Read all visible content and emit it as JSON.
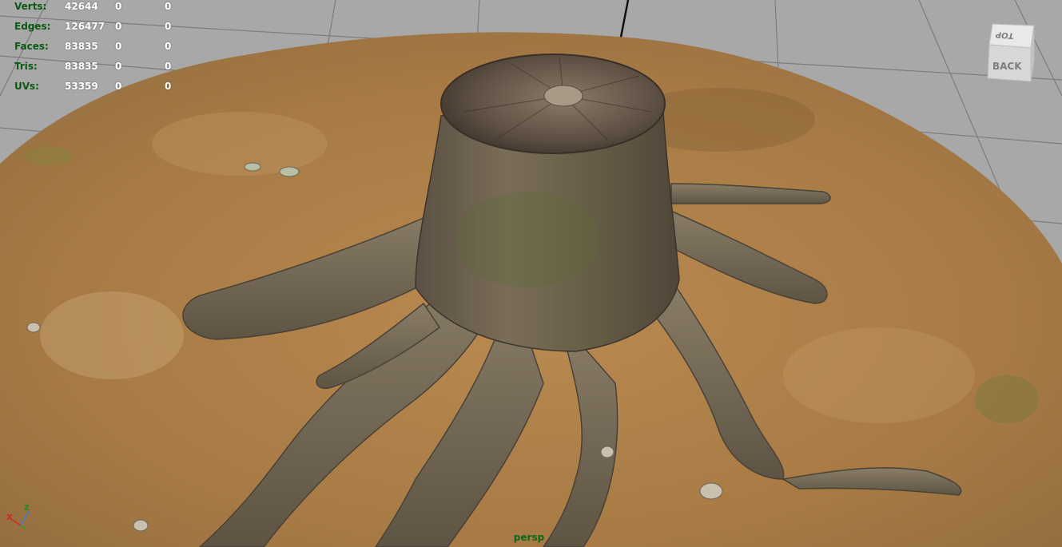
{
  "hud": {
    "rows": [
      {
        "label": "Verts:",
        "v1": "42644",
        "v2": "0",
        "v3": "0"
      },
      {
        "label": "Edges:",
        "v1": "126477",
        "v2": "0",
        "v3": "0"
      },
      {
        "label": "Faces:",
        "v1": "83835",
        "v2": "0",
        "v3": "0"
      },
      {
        "label": "Tris:",
        "v1": "83835",
        "v2": "0",
        "v3": "0"
      },
      {
        "label": "UVs:",
        "v1": "53359",
        "v2": "0",
        "v3": "0"
      }
    ]
  },
  "viewcube": {
    "top_label": "TOP",
    "front_label": "BACK"
  },
  "axis": {
    "x": "x",
    "z": "z"
  },
  "camera": {
    "name": "persp"
  },
  "colors": {
    "viewport_bg": "#a8a8a8",
    "grid_line": "#7c7c7c",
    "ground": "#a77a45",
    "stump_bark": "#6d6253",
    "hud_label": "#0b5a14",
    "hud_value": "#ffffff",
    "camera_label": "#0b6a1a"
  }
}
